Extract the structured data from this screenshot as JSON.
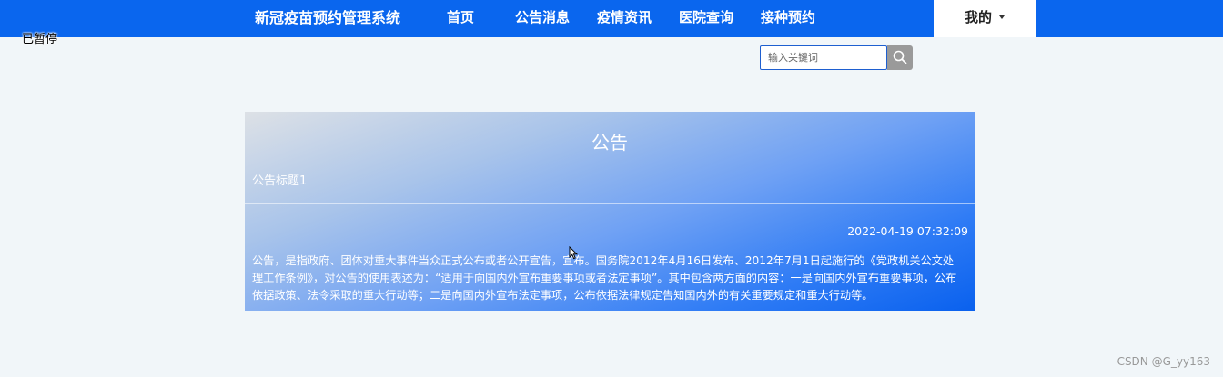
{
  "header": {
    "brand": "新冠疫苗预约管理系统",
    "nav": [
      {
        "label": "首页"
      },
      {
        "label": "公告消息"
      },
      {
        "label": "疫情资讯"
      },
      {
        "label": "医院查询"
      },
      {
        "label": "接种预约"
      }
    ],
    "user_menu": "我的"
  },
  "overlay": {
    "paused": "已暂停"
  },
  "search": {
    "placeholder": "输入关键词",
    "value": ""
  },
  "notice": {
    "heading": "公告",
    "title": "公告标题1",
    "date": "2022-04-19 07:32:09",
    "content": "公告，是指政府、团体对重大事件当众正式公布或者公开宣告，宣布。国务院2012年4月16日发布、2012年7月1日起施行的《党政机关公文处理工作条例》，对公告的使用表述为：“适用于向国内外宣布重要事项或者法定事项”。其中包含两方面的内容：一是向国内外宣布重要事项，公布依据政策、法令采取的重大行动等；二是向国内外宣布法定事项，公布依据法律规定告知国内外的有关重要规定和重大行动等。"
  },
  "watermark": "CSDN @G_yy163",
  "colors": {
    "topbar": "#0a66ee",
    "page_background": "#f1f6f9",
    "search_button": "#9a9a9a"
  }
}
